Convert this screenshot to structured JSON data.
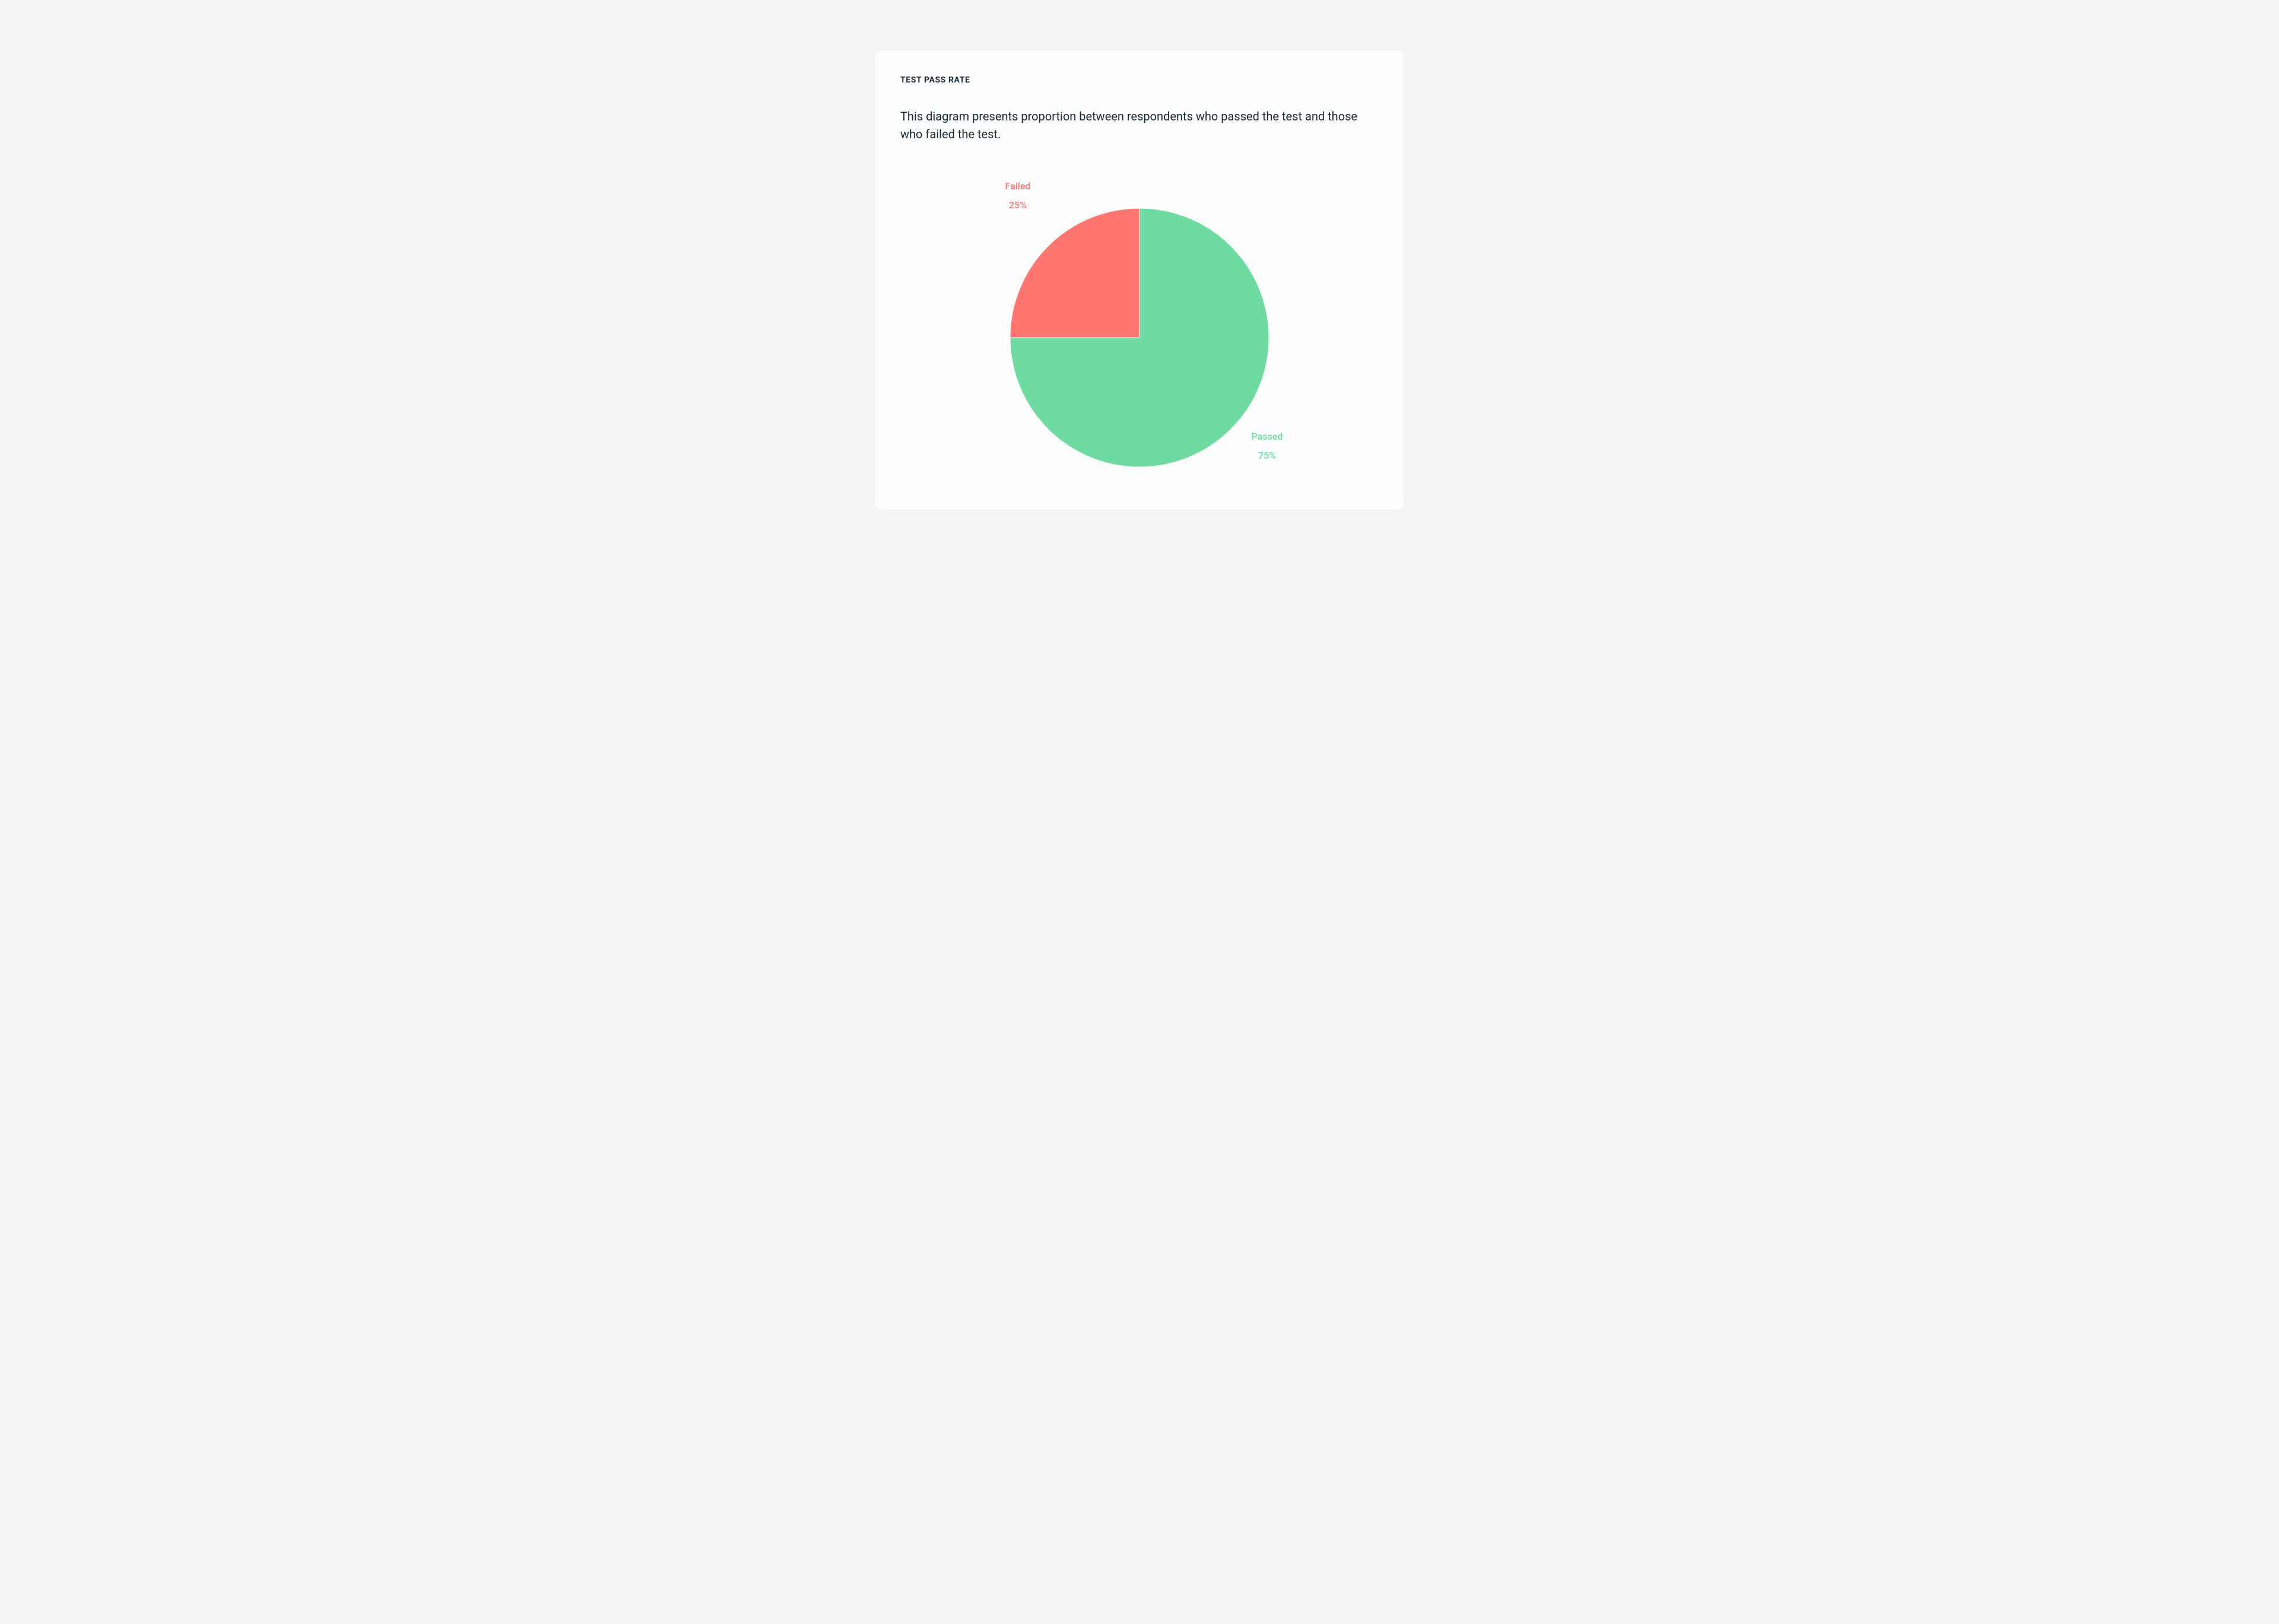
{
  "card": {
    "title": "TEST PASS RATE",
    "description": "This diagram presents proportion between respondents who passed the test and those who failed the test."
  },
  "chart_data": {
    "type": "pie",
    "title": "Test Pass Rate",
    "slices": [
      {
        "name": "Passed",
        "value": 75,
        "percent_label": "75%",
        "color": "#6edba1"
      },
      {
        "name": "Failed",
        "value": 25,
        "percent_label": "25%",
        "color": "#ff7570"
      }
    ]
  }
}
